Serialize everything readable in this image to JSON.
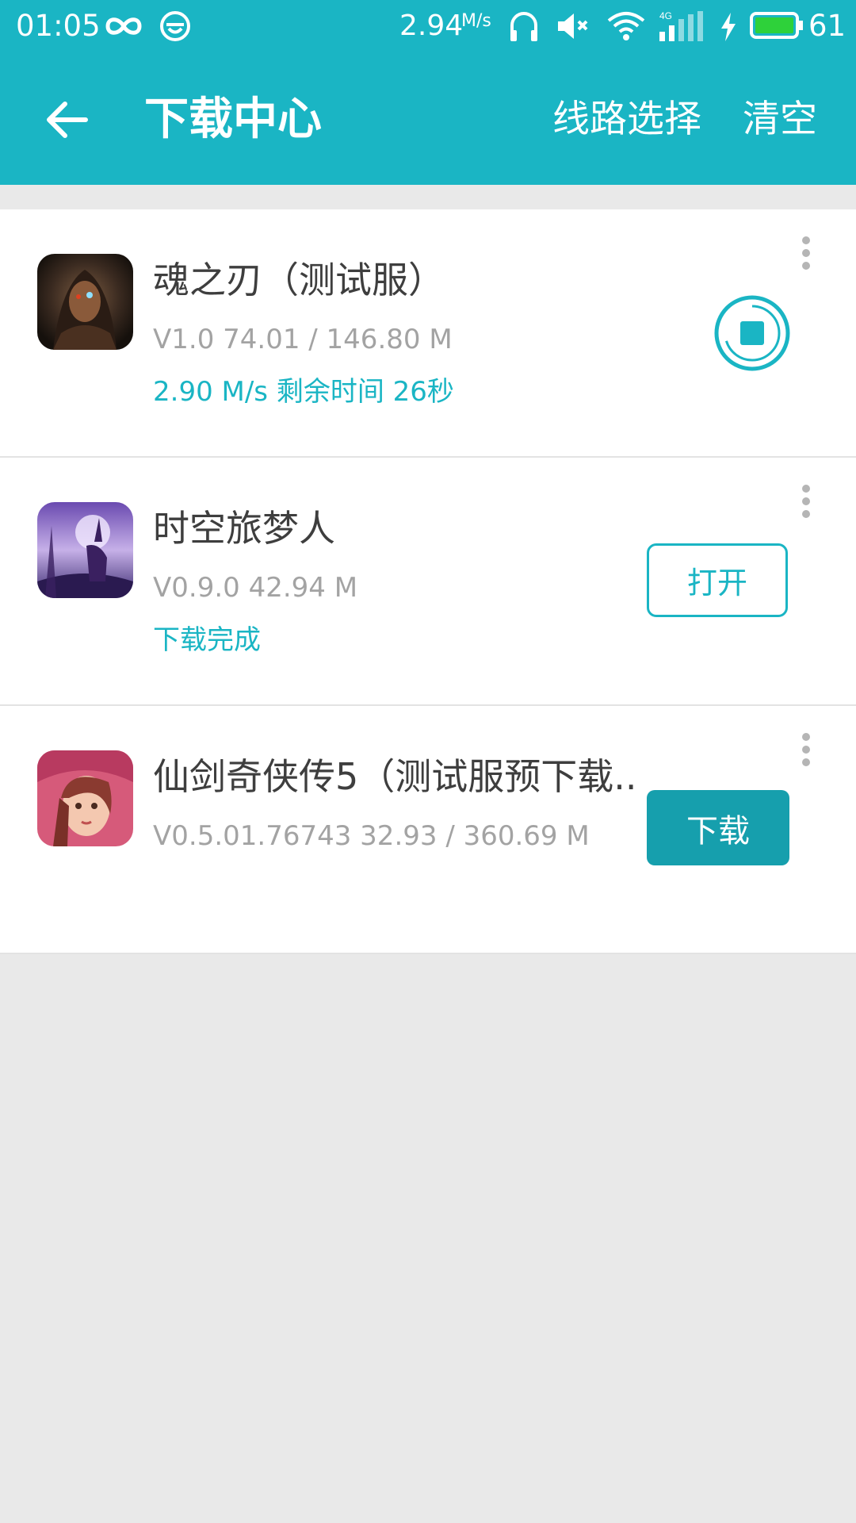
{
  "status_bar": {
    "time": "01:05",
    "net_speed": "2.94",
    "net_speed_unit": "M/s",
    "battery": "61"
  },
  "header": {
    "title": "下载中心",
    "route_select": "线路选择",
    "clear": "清空"
  },
  "downloads": [
    {
      "name": "魂之刃（测试服）",
      "meta": "V1.0  74.01 / 146.80 M",
      "status": "2.90 M/s  剩余时间 26秒",
      "action": "stop"
    },
    {
      "name": "时空旅梦人",
      "meta": "V0.9.0  42.94 M",
      "status": "下载完成",
      "action_label": "打开"
    },
    {
      "name": "仙剑奇侠传5（测试服预下载..",
      "meta": "V0.5.01.76743  32.93 / 360.69 M",
      "action_label": "下载"
    }
  ],
  "colors": {
    "accent": "#1ab5c4",
    "button_dark": "#169fad",
    "background": "#e9e9e9"
  }
}
